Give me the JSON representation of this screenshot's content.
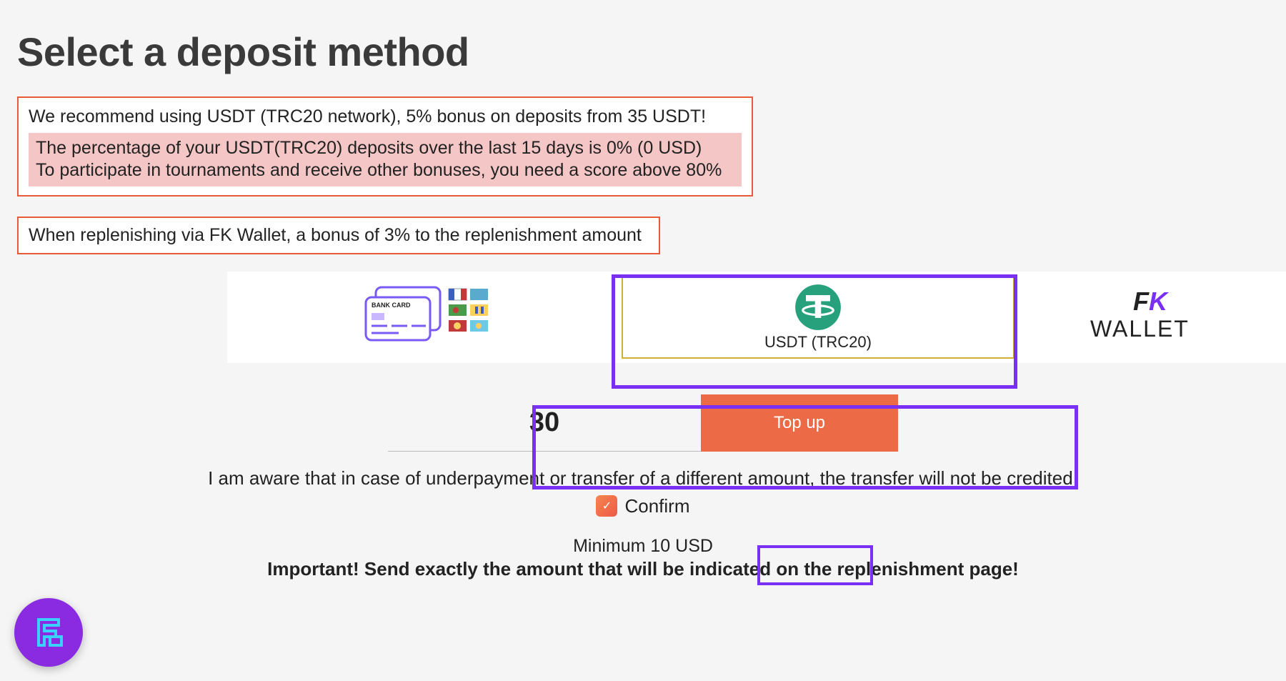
{
  "title": "Select a deposit method",
  "info1": {
    "recommend": "We recommend using USDT (TRC20 network), 5% bonus on deposits from 35 USDT!",
    "pct_line": "The percentage of your USDT(TRC20) deposits over the last 15 days is 0% (0 USD)",
    "score_line": "To participate in tournaments and receive other bonuses, you need a score above 80%"
  },
  "info2": "When replenishing via FK Wallet, a bonus of 3% to the replenishment amount",
  "methods": {
    "bank_card_label": "BANK CARD",
    "usdt_label": "USDT (TRC20)",
    "fk_label_top": "FK",
    "fk_label_bottom": "WALLET"
  },
  "amount": {
    "value": "30",
    "topup_label": "Top up"
  },
  "disclaimer": "I am aware that in case of underpayment or transfer of a different amount, the transfer will not be credited!",
  "confirm_label": "Confirm",
  "minimum_line": "Minimum 10 USD",
  "important_line": "Important! Send exactly the amount that will be indicated on the replenishment page!"
}
